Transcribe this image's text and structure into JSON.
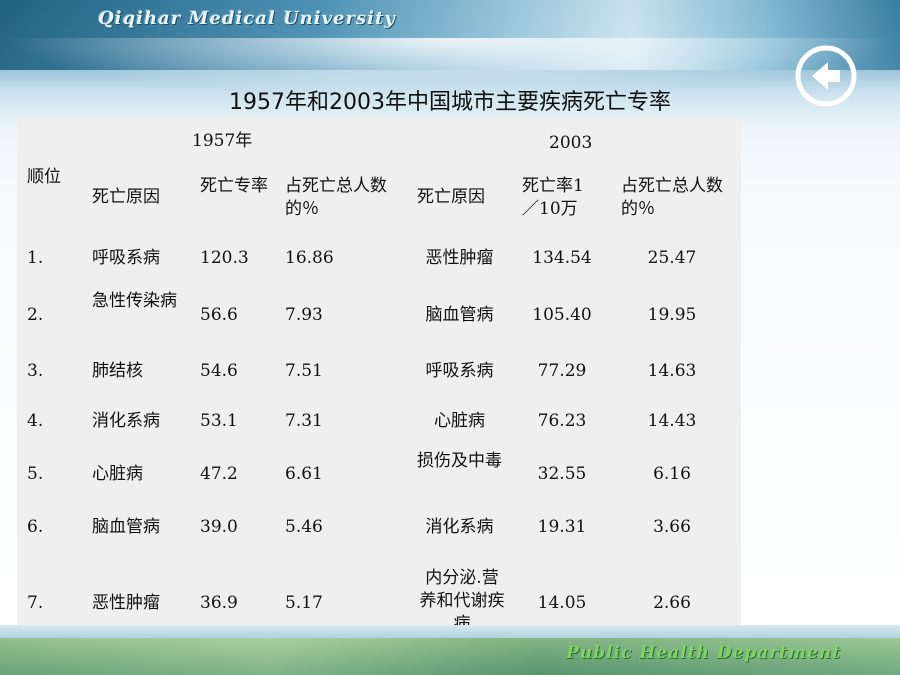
{
  "header": {
    "logo_text": "Qiqihar Medical University"
  },
  "nav": {
    "back_icon": "back-arrow-icon"
  },
  "footer": {
    "text": "Public Health Department"
  },
  "title": "1957年和2003年中国城市主要疾病死亡专率",
  "table": {
    "rank_header": "顺位",
    "year1": "1957年",
    "year2": "2003",
    "cause_header": "死亡原因",
    "rate_header_1957": "死亡专率",
    "pct_header": "占死亡总人数的％",
    "rate_header_2003": "死亡率1／10万",
    "rows": [
      {
        "rank": "1.",
        "cause_1957": "呼吸系病",
        "rate_1957": "120.3",
        "pct_1957": "16.86",
        "cause_2003": "恶性肿瘤",
        "rate_2003": "134.54",
        "pct_2003": "25.47"
      },
      {
        "rank": "2.",
        "cause_1957": "急性传染病",
        "rate_1957": "56.6",
        "pct_1957": "7.93",
        "cause_2003": "脑血管病",
        "rate_2003": "105.40",
        "pct_2003": "19.95"
      },
      {
        "rank": "3.",
        "cause_1957": "肺结核",
        "rate_1957": "54.6",
        "pct_1957": "7.51",
        "cause_2003": "呼吸系病",
        "rate_2003": "77.29",
        "pct_2003": "14.63"
      },
      {
        "rank": "4.",
        "cause_1957": "消化系病",
        "rate_1957": "53.1",
        "pct_1957": "7.31",
        "cause_2003": "心脏病",
        "rate_2003": "76.23",
        "pct_2003": "14.43"
      },
      {
        "rank": "5.",
        "cause_1957": "心脏病",
        "rate_1957": "47.2",
        "pct_1957": "6.61",
        "cause_2003": "损伤及中毒",
        "rate_2003": "32.55",
        "pct_2003": "6.16"
      },
      {
        "rank": "6.",
        "cause_1957": "脑血管病",
        "rate_1957": "39.0",
        "pct_1957": "5.46",
        "cause_2003": "消化系病",
        "rate_2003": "19.31",
        "pct_2003": "3.66"
      },
      {
        "rank": "7.",
        "cause_1957": "恶性肿瘤",
        "rate_1957": "36.9",
        "pct_1957": "5.17",
        "cause_2003": "内分泌.营养和代谢疾病",
        "rate_2003": "14.05",
        "pct_2003": "2.66"
      }
    ]
  }
}
